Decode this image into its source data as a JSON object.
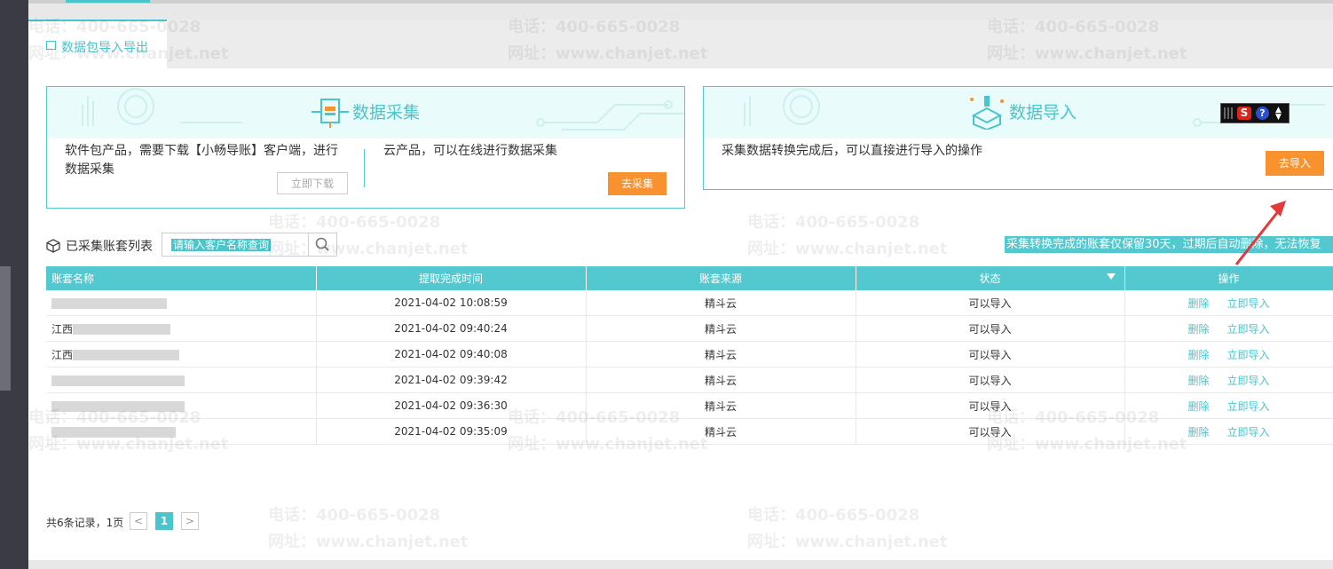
{
  "tab": {
    "label": "数据包导入导出"
  },
  "collect_card": {
    "title": "数据采集",
    "left_text": "软件包产品，需要下载【小畅导账】客户端，进行数据采集",
    "download_btn": "立即下载",
    "right_text": "云产品，可以在线进行数据采集",
    "collect_btn": "去采集"
  },
  "import_card": {
    "title": "数据导入",
    "text": "采集数据转换完成后，可以直接进行导入的操作",
    "import_btn": "去导入"
  },
  "list": {
    "title": "已采集账套列表",
    "search_placeholder": "请输入客户名称查询",
    "notice": "采集转换完成的账套仅保留30天，过期后自动删除，无法恢复"
  },
  "table": {
    "headers": [
      "账套名称",
      "提取完成时间",
      "账套来源",
      "状态",
      "操作"
    ],
    "rows": [
      {
        "account": "",
        "time": "2021-04-02 10:08:59",
        "source": "精斗云",
        "status": "可以导入",
        "del": "删除",
        "imp": "立即导入"
      },
      {
        "account": "江西",
        "time": "2021-04-02 09:40:24",
        "source": "精斗云",
        "status": "可以导入",
        "del": "删除",
        "imp": "立即导入"
      },
      {
        "account": "江西",
        "time": "2021-04-02 09:40:08",
        "source": "精斗云",
        "status": "可以导入",
        "del": "删除",
        "imp": "立即导入"
      },
      {
        "account": "",
        "time": "2021-04-02 09:39:42",
        "source": "精斗云",
        "status": "可以导入",
        "del": "删除",
        "imp": "立即导入"
      },
      {
        "account": "",
        "time": "2021-04-02 09:36:30",
        "source": "精斗云",
        "status": "可以导入",
        "del": "删除",
        "imp": "立即导入"
      },
      {
        "account": "",
        "time": "2021-04-02 09:35:09",
        "source": "精斗云",
        "status": "可以导入",
        "del": "删除",
        "imp": "立即导入"
      }
    ]
  },
  "pager": {
    "info": "共6条记录，1页",
    "prev": "<",
    "current": "1",
    "next": ">"
  },
  "watermark": {
    "phone": "电话：400-665-0028",
    "site": "网址：www.chanjet.net"
  },
  "colors": {
    "accent": "#49c5cb",
    "header": "#53c9cf",
    "orange": "#f7922f",
    "arrow": "#e23a3a"
  }
}
